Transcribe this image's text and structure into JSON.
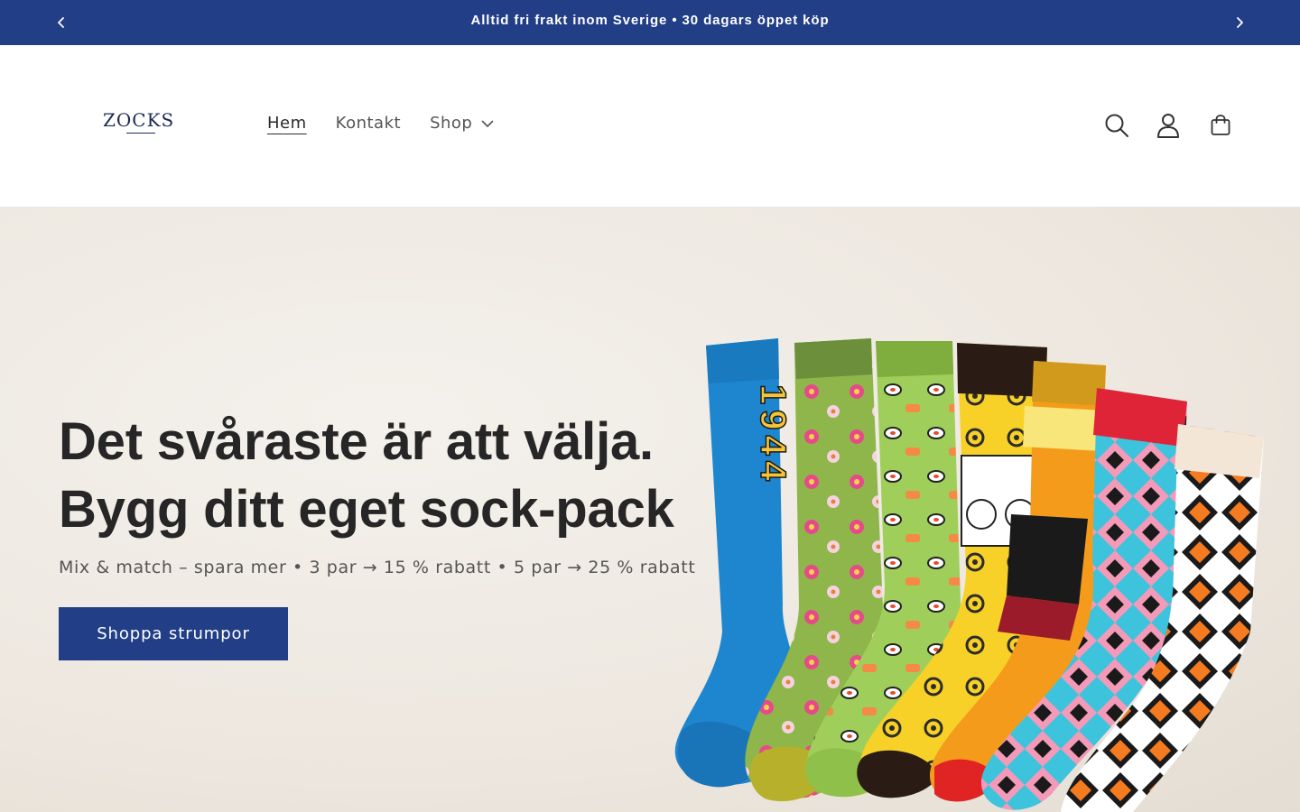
{
  "announcement": {
    "text": "Alltid fri frakt inom Sverige • 30 dagars öppet köp"
  },
  "header": {
    "logo": "ZOCKS",
    "nav": [
      {
        "label": "Hem",
        "active": true
      },
      {
        "label": "Kontakt",
        "active": false
      },
      {
        "label": "Shop",
        "active": false
      }
    ],
    "icons": [
      "search-icon",
      "account-icon",
      "cart-icon"
    ]
  },
  "hero": {
    "title_line1": "Det svåraste är att välja.",
    "title_line2": "Bygg ditt eget sock-pack",
    "subtitle": "Mix & match – spara mer • 3 par → 15 % rabatt • 5 par → 25 % rabatt",
    "button": "Shoppa strumpor",
    "sock_number": "1944"
  },
  "colors": {
    "brand_blue": "#213e87",
    "text_dark": "#262626",
    "hero_bg": "#ede7df"
  }
}
